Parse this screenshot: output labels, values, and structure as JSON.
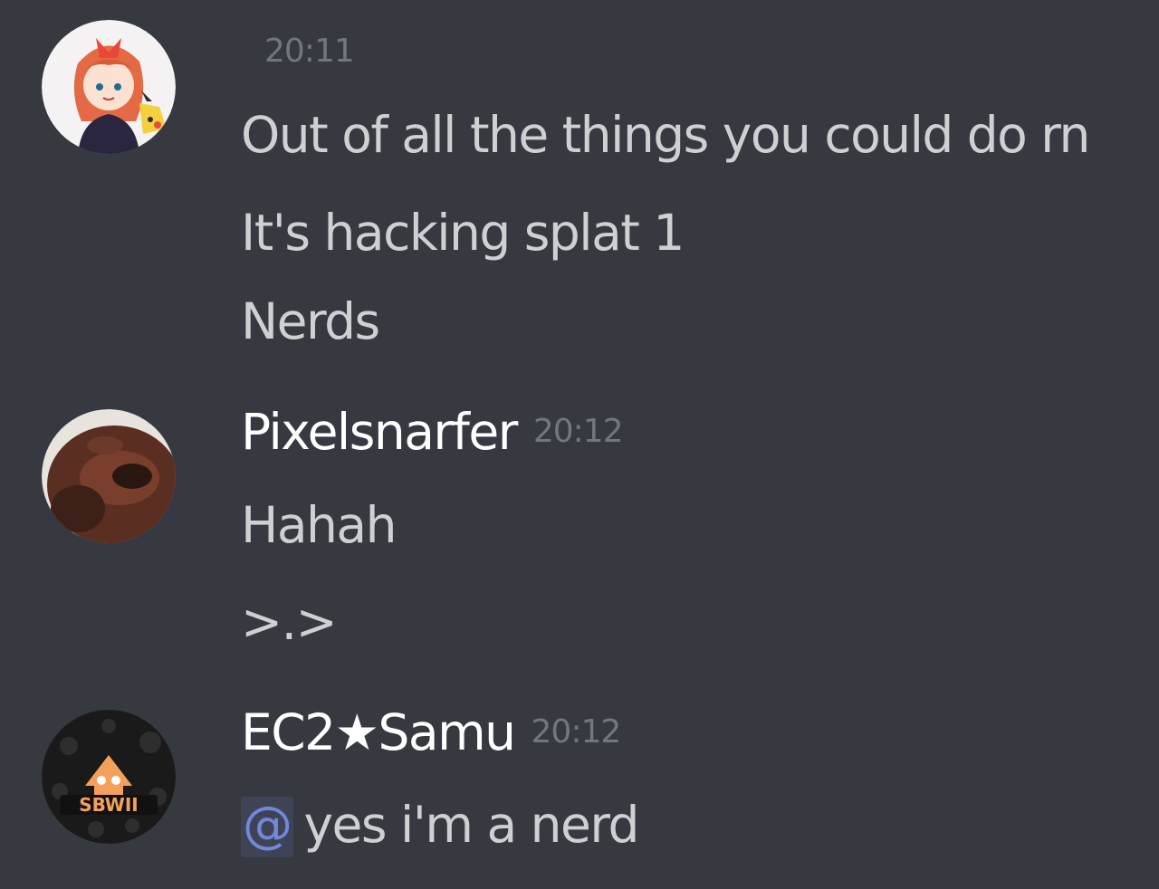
{
  "groups": [
    {
      "timestamp": "20:11",
      "avatar_icon": "anime-girl-pikachu-avatar",
      "messages": [
        "Out of all the things you could do rn",
        "It's hacking splat 1",
        "Nerds"
      ]
    },
    {
      "username": "Pixelsnarfer",
      "timestamp": "20:12",
      "avatar_icon": "closeup-face-avatar",
      "messages": [
        "Hahah",
        ">.>"
      ]
    },
    {
      "username": "EC2★Samu",
      "timestamp": "20:12",
      "avatar_icon": "squid-sbwii-logo-avatar",
      "avatar_text": "SBWII",
      "mention": "@",
      "messages": [
        "yes i'm a nerd"
      ]
    }
  ],
  "colors": {
    "background": "#36393f",
    "username": "#ffffff",
    "message_text": "#dcddde",
    "timestamp": "#72767d",
    "mention": "#7289da"
  }
}
